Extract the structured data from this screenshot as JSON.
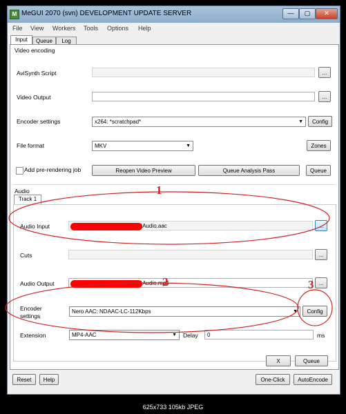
{
  "window": {
    "icon_letter": "M",
    "title": "MeGUI 2070 (svn) DEVELOPMENT UPDATE SERVER",
    "min_glyph": "—",
    "max_glyph": "▢",
    "close_glyph": "✕"
  },
  "menu": [
    "File",
    "View",
    "Workers",
    "Tools",
    "Options",
    "Help"
  ],
  "tabs": [
    "Input",
    "Queue",
    "Log"
  ],
  "video": {
    "section_title": "Video encoding",
    "avisynth_label": "AviSynth Script",
    "avisynth_value": "",
    "output_label": "Video Output",
    "output_value": "",
    "encoder_label": "Encoder settings",
    "encoder_value": "x264: *scratchpad*",
    "format_label": "File format",
    "format_value": "MKV",
    "browse": "...",
    "config": "Config",
    "zones": "Zones",
    "prerender_label": "Add pre-rendering job",
    "reopen_preview": "Reopen Video Preview",
    "queue_analysis": "Queue Analysis Pass",
    "queue": "Queue"
  },
  "audio": {
    "section_title": "Audio",
    "track_tab": "Track 1",
    "input_label": "Audio Input",
    "input_value": "\\Audio.aac",
    "cuts_label": "Cuts",
    "cuts_value": "",
    "output_label": "Audio Output",
    "output_value": "\\Audio.mp4",
    "encoder_label_1": "Encoder",
    "encoder_label_2": "settings",
    "encoder_value": "Nero AAC: NDAAC-LC-112Kbps",
    "config": "Config",
    "extension_label": "Extension",
    "extension_value": "MP4-AAC",
    "delay_label": "Delay",
    "delay_value": "0",
    "delay_unit": "ms",
    "browse": "...",
    "remove": "X",
    "queue": "Queue"
  },
  "footer": {
    "reset": "Reset",
    "help": "Help",
    "one_click": "One-Click",
    "auto_encode": "AutoEncode"
  },
  "annotations": {
    "one": "1",
    "two": "2",
    "three": "3",
    "color": "#d02020"
  },
  "image_info": "625x733  105kb  JPEG"
}
